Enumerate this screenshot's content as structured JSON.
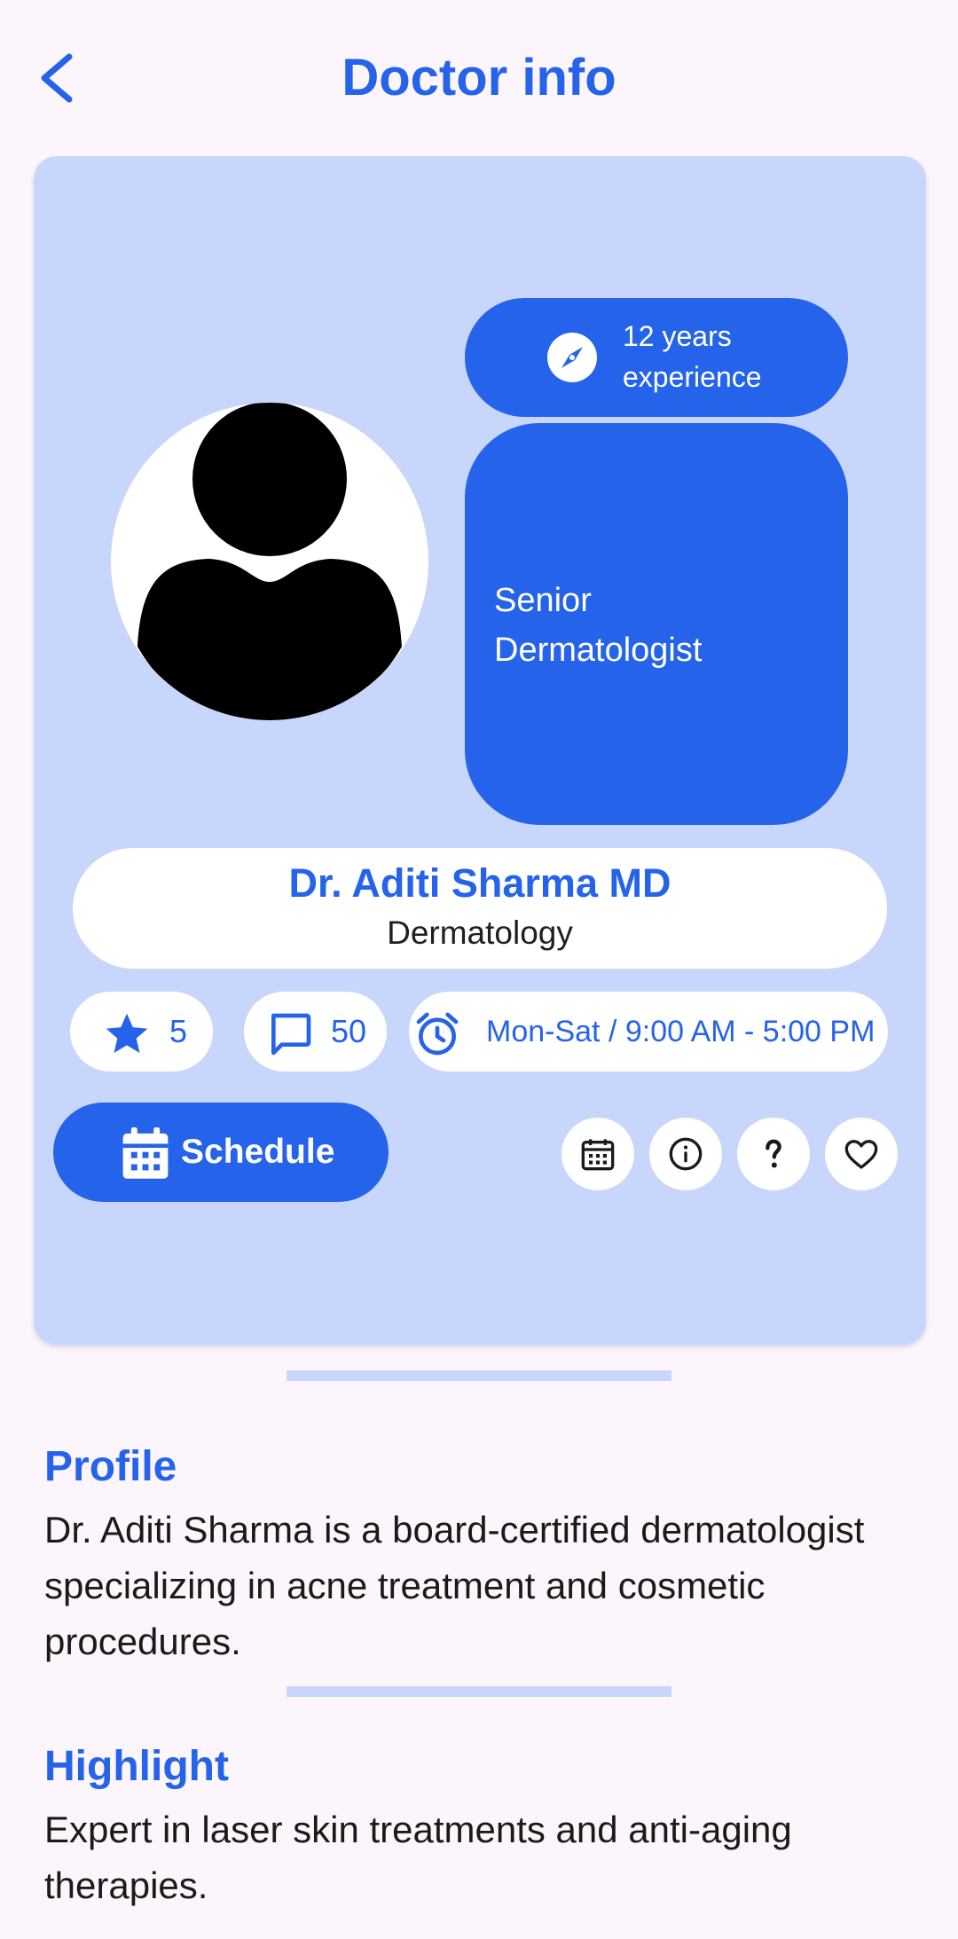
{
  "header": {
    "title": "Doctor info",
    "back_icon": "chevron-left-icon"
  },
  "doctor": {
    "experience": "12 years experience",
    "role": "Senior Dermatologist",
    "name": "Dr. Aditi Sharma MD",
    "specialty": "Dermatology"
  },
  "stats": {
    "rating": "5",
    "reviews": "50",
    "hours": "Mon-Sat / 9:00 AM - 5:00 PM"
  },
  "actions": {
    "schedule_label": "Schedule",
    "icons": [
      "calendar-icon",
      "info-icon",
      "question-icon",
      "heart-icon"
    ]
  },
  "profile": {
    "title": "Profile",
    "body": "Dr. Aditi Sharma is a board-certified dermatologist specializing in acne treatment and cosmetic procedures."
  },
  "highlight": {
    "title": "Highlight",
    "body": "Expert in laser skin treatments and anti-aging therapies."
  },
  "colors": {
    "accent": "#2563eb",
    "card_bg": "#c9d6fc",
    "page_bg": "#fcf6fc"
  }
}
